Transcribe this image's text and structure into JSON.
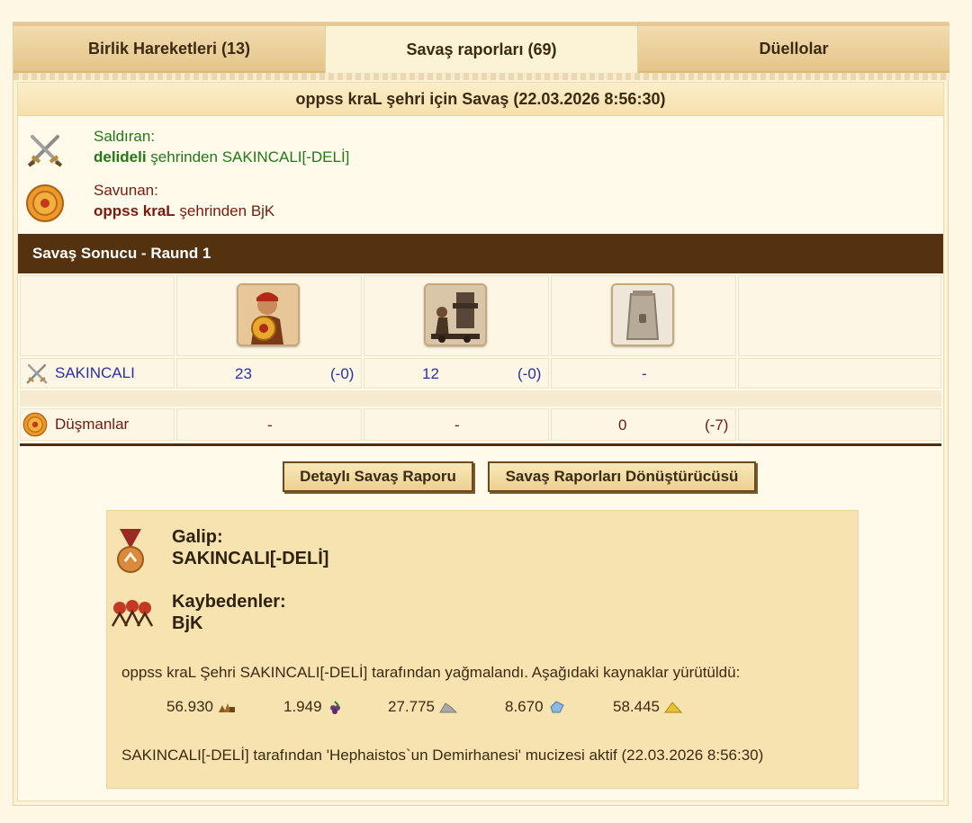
{
  "tabs": [
    {
      "label": "Birlik Hareketleri (13)"
    },
    {
      "label": "Savaş raporları (69)"
    },
    {
      "label": "Düellolar"
    }
  ],
  "report": {
    "title": "oppss kraL şehri için Savaş (22.03.2026 8:56:30)",
    "attacker": {
      "role": "Saldıran:",
      "city": "delideli",
      "from_text": " şehrinden SAKINCALI[-DELİ]"
    },
    "defender": {
      "role": "Savunan:",
      "city": "oppss kraL",
      "from_text": " şehrinden BjK"
    }
  },
  "battle": {
    "header": "Savaş Sonucu - Raund 1",
    "rows": [
      {
        "name": "SAKINCALI",
        "cells": [
          "23",
          "(-0)",
          "12",
          "(-0)",
          "-",
          ""
        ]
      },
      {
        "name": "Düşmanlar",
        "cells": [
          "-",
          "",
          "-",
          "",
          "0",
          "(-7)"
        ]
      }
    ]
  },
  "buttons": {
    "detail": "Detaylı Savaş Raporu",
    "converter": "Savaş Raporları Dönüştürücüsü"
  },
  "summary": {
    "winner_label": "Galip:",
    "winner": "SAKINCALI[-DELİ]",
    "losers_label": "Kaybedenler:",
    "losers": "BjK",
    "plunder_text": "oppss kraL Şehri SAKINCALI[-DELİ] tarafından yağmalandı. Aşağıdaki kaynaklar yürütüldü:",
    "resources": [
      {
        "value": "56.930",
        "icon": "wood-icon"
      },
      {
        "value": "1.949",
        "icon": "wine-icon"
      },
      {
        "value": "27.775",
        "icon": "marble-icon"
      },
      {
        "value": "8.670",
        "icon": "crystal-icon"
      },
      {
        "value": "58.445",
        "icon": "sulfur-icon"
      }
    ],
    "wonder_text": "SAKINCALI[-DELİ] tarafından 'Hephaistos`un Demirhanesi' mucizesi aktif (22.03.2026 8:56:30)"
  }
}
